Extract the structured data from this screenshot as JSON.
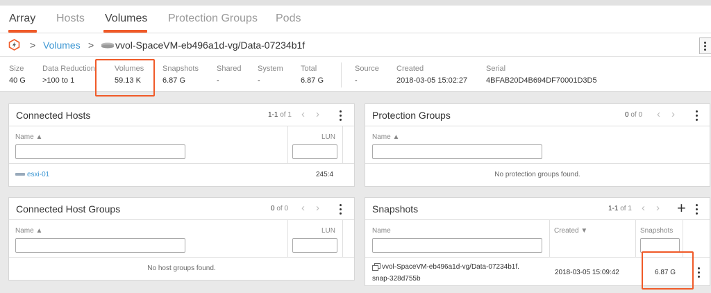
{
  "nav": {
    "tabs": [
      {
        "label": "Array",
        "active": true
      },
      {
        "label": "Hosts",
        "active": false
      },
      {
        "label": "Volumes",
        "active": true
      },
      {
        "label": "Protection Groups",
        "active": false
      },
      {
        "label": "Pods",
        "active": false
      }
    ]
  },
  "breadcrumb": {
    "sep": ">",
    "volumes": "Volumes",
    "current": "vvol-SpaceVM-eb496a1d-vg/Data-07234b1f"
  },
  "stats": {
    "size": {
      "label": "Size",
      "value": "40 G"
    },
    "data_reduction": {
      "label": "Data Reduction",
      "value": ">100 to 1"
    },
    "volumes": {
      "label": "Volumes",
      "value": "59.13 K"
    },
    "snapshots": {
      "label": "Snapshots",
      "value": "6.87 G"
    },
    "shared": {
      "label": "Shared",
      "value": "-"
    },
    "system": {
      "label": "System",
      "value": "-"
    },
    "total": {
      "label": "Total",
      "value": "6.87 G"
    },
    "source": {
      "label": "Source",
      "value": "-"
    },
    "created": {
      "label": "Created",
      "value": "2018-03-05 15:02:27"
    },
    "serial": {
      "label": "Serial",
      "value": "4BFAB20D4B694DF70001D3D5"
    }
  },
  "connected_hosts": {
    "title": "Connected Hosts",
    "pager_range": "1-1",
    "pager_of": "of 1",
    "col_name": "Name",
    "col_lun": "LUN",
    "rows": [
      {
        "name": "esxi-01",
        "lun": "245:4"
      }
    ]
  },
  "protection_groups": {
    "title": "Protection Groups",
    "pager_range": "0",
    "pager_of": "of 0",
    "col_name": "Name",
    "empty": "No protection groups found."
  },
  "connected_host_groups": {
    "title": "Connected Host Groups",
    "pager_range": "0",
    "pager_of": "of 0",
    "col_name": "Name",
    "col_lun": "LUN",
    "empty": "No host groups found."
  },
  "snapshots": {
    "title": "Snapshots",
    "pager_range": "1-1",
    "pager_of": "of 1",
    "col_name": "Name",
    "col_created": "Created",
    "col_snapshots": "Snapshots",
    "rows": [
      {
        "name_line1": "vvol-SpaceVM-eb496a1d-vg/Data-07234b1f.",
        "name_line2": "snap-328d755b",
        "created": "2018-03-05 15:09:42",
        "size": "6.87 G"
      }
    ]
  },
  "colors": {
    "accent": "#f05a28",
    "link": "#3d97d3"
  }
}
